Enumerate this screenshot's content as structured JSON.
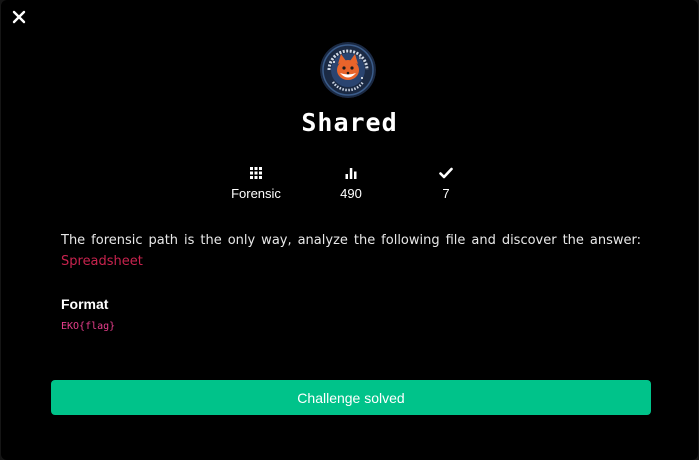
{
  "window": {
    "close_icon": "close-icon"
  },
  "challenge": {
    "logo_icon": "fox-astronaut-badge-icon",
    "title": "Shared",
    "stats": {
      "category": {
        "icon": "grid-icon",
        "value": "Forensic"
      },
      "points": {
        "icon": "bar-chart-icon",
        "value": "490"
      },
      "solves": {
        "icon": "check-icon",
        "value": "7"
      }
    },
    "description": {
      "text": "The forensic path is the only way, analyze the following file and discover the answer: ",
      "link_label": "Spreadsheet"
    },
    "format": {
      "heading": "Format",
      "value": "EKO{flag}"
    },
    "action": {
      "label": "Challenge solved"
    }
  },
  "colors": {
    "background": "#000000",
    "accent": "#00c38a",
    "link": "#c8234e",
    "code": "#e83e8c"
  }
}
